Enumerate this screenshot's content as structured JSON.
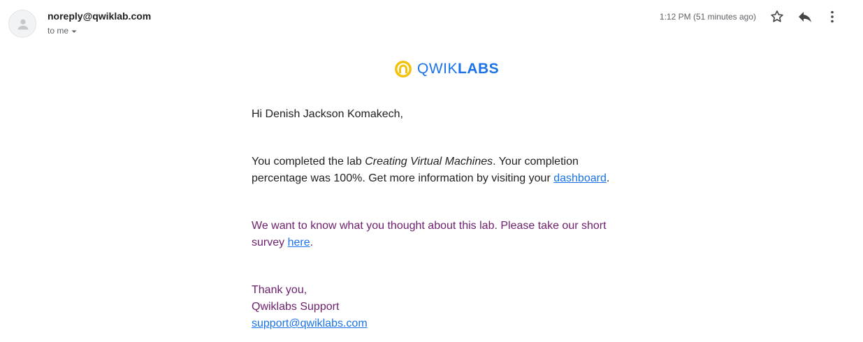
{
  "header": {
    "sender": "noreply@qwiklab.com",
    "recipient": "to me",
    "timestamp": "1:12 PM (51 minutes ago)",
    "icons": [
      "avatar-icon",
      "star-icon",
      "reply-icon",
      "more-vert-icon"
    ]
  },
  "logo": {
    "light": "QWIK",
    "bold": "LABS"
  },
  "email": {
    "greeting": "Hi Denish Jackson Komakech,",
    "para1_prefix": "You completed the lab ",
    "lab_name": "Creating Virtual Machines",
    "para1_middle": ". Your completion percentage was 100%. Get more information by visiting your ",
    "dashboard_link": "dashboard",
    "para1_suffix": ".",
    "para2_prefix": "We want to know what you thought about this lab. Please take our short survey ",
    "survey_link": "here",
    "para2_suffix": ".",
    "sign_off": "Thank you,",
    "sign_name": "Qwiklabs Support",
    "support_email": "support@qwiklabs.com"
  },
  "colors": {
    "link": "#1a73e8",
    "purple_text": "#6d1f6d",
    "logo_yellow": "#f4c20d"
  }
}
